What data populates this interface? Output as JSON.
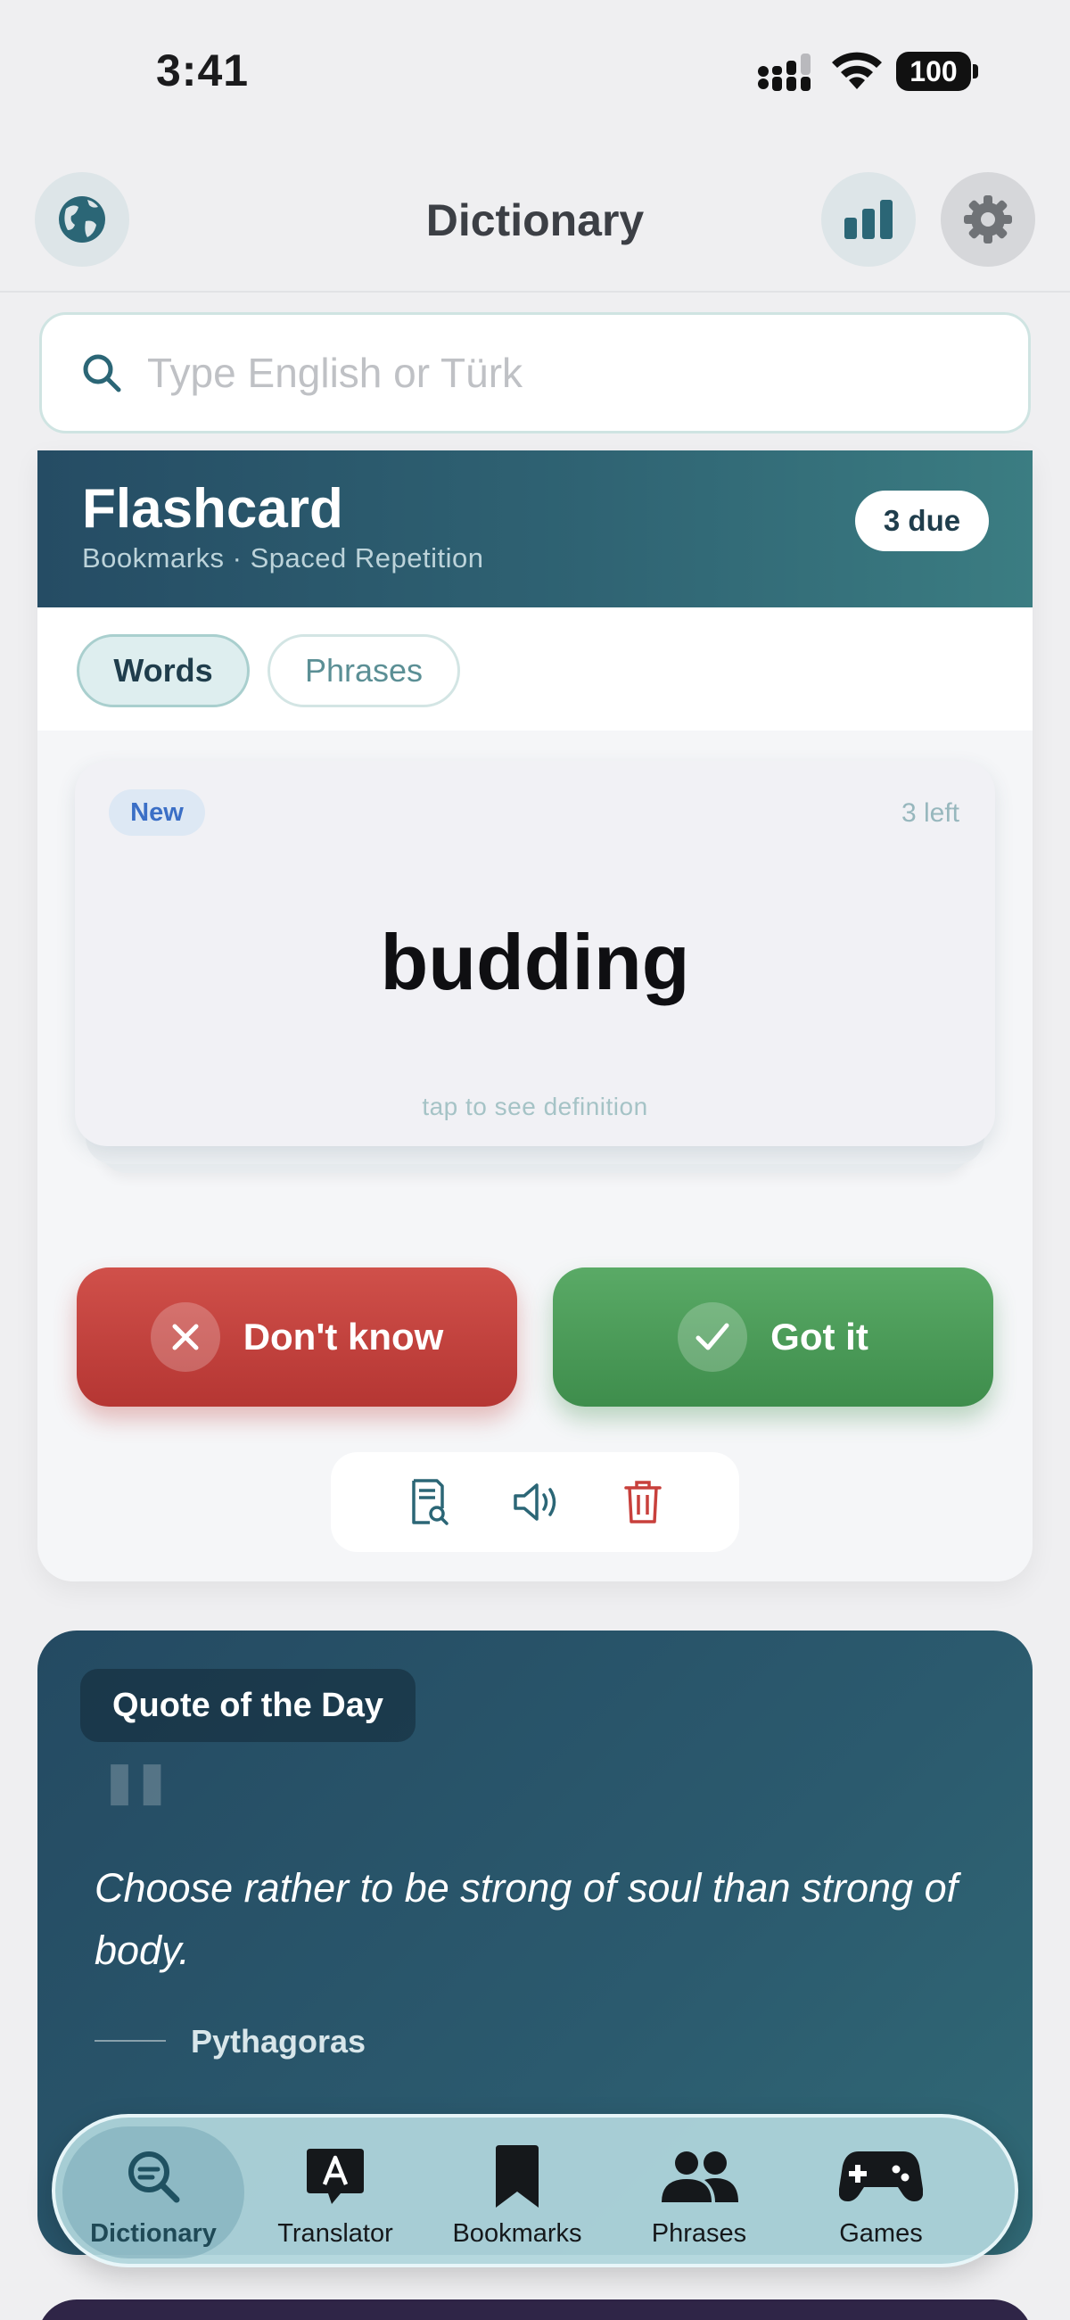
{
  "status_bar": {
    "time": "3:41",
    "battery": "100"
  },
  "header": {
    "title": "Dictionary",
    "icons": [
      "globe-icon",
      "bar-chart-icon",
      "gear-icon"
    ]
  },
  "search": {
    "placeholder": "Type English or Türk",
    "value": ""
  },
  "flashcard": {
    "title": "Flashcard",
    "subtitle": "Bookmarks · Spaced Repetition",
    "due_badge": "3 due",
    "tabs": [
      {
        "label": "Words",
        "active": true
      },
      {
        "label": "Phrases",
        "active": false
      }
    ],
    "card": {
      "badge": "New",
      "remaining": "3 left",
      "word": "budding",
      "hint": "tap to see definition"
    },
    "actions": {
      "dont_know": "Don't know",
      "got_it": "Got it"
    },
    "tools": [
      "definition-search-icon",
      "speaker-icon",
      "trash-icon"
    ]
  },
  "quote": {
    "tag": "Quote of the Day",
    "text": "Choose rather to be strong of soul than strong of body.",
    "author": "Pythagoras"
  },
  "tab_bar": {
    "items": [
      {
        "label": "Dictionary",
        "icon": "search-icon",
        "active": true
      },
      {
        "label": "Translator",
        "icon": "translator-icon",
        "active": false
      },
      {
        "label": "Bookmarks",
        "icon": "bookmark-icon",
        "active": false
      },
      {
        "label": "Phrases",
        "icon": "people-icon",
        "active": false
      },
      {
        "label": "Games",
        "icon": "gamepad-icon",
        "active": false
      }
    ]
  },
  "colors": {
    "accent": "#2f6373",
    "danger": "#c0403c",
    "success": "#4a9b58",
    "tab_bar": "#b0d6dd"
  }
}
